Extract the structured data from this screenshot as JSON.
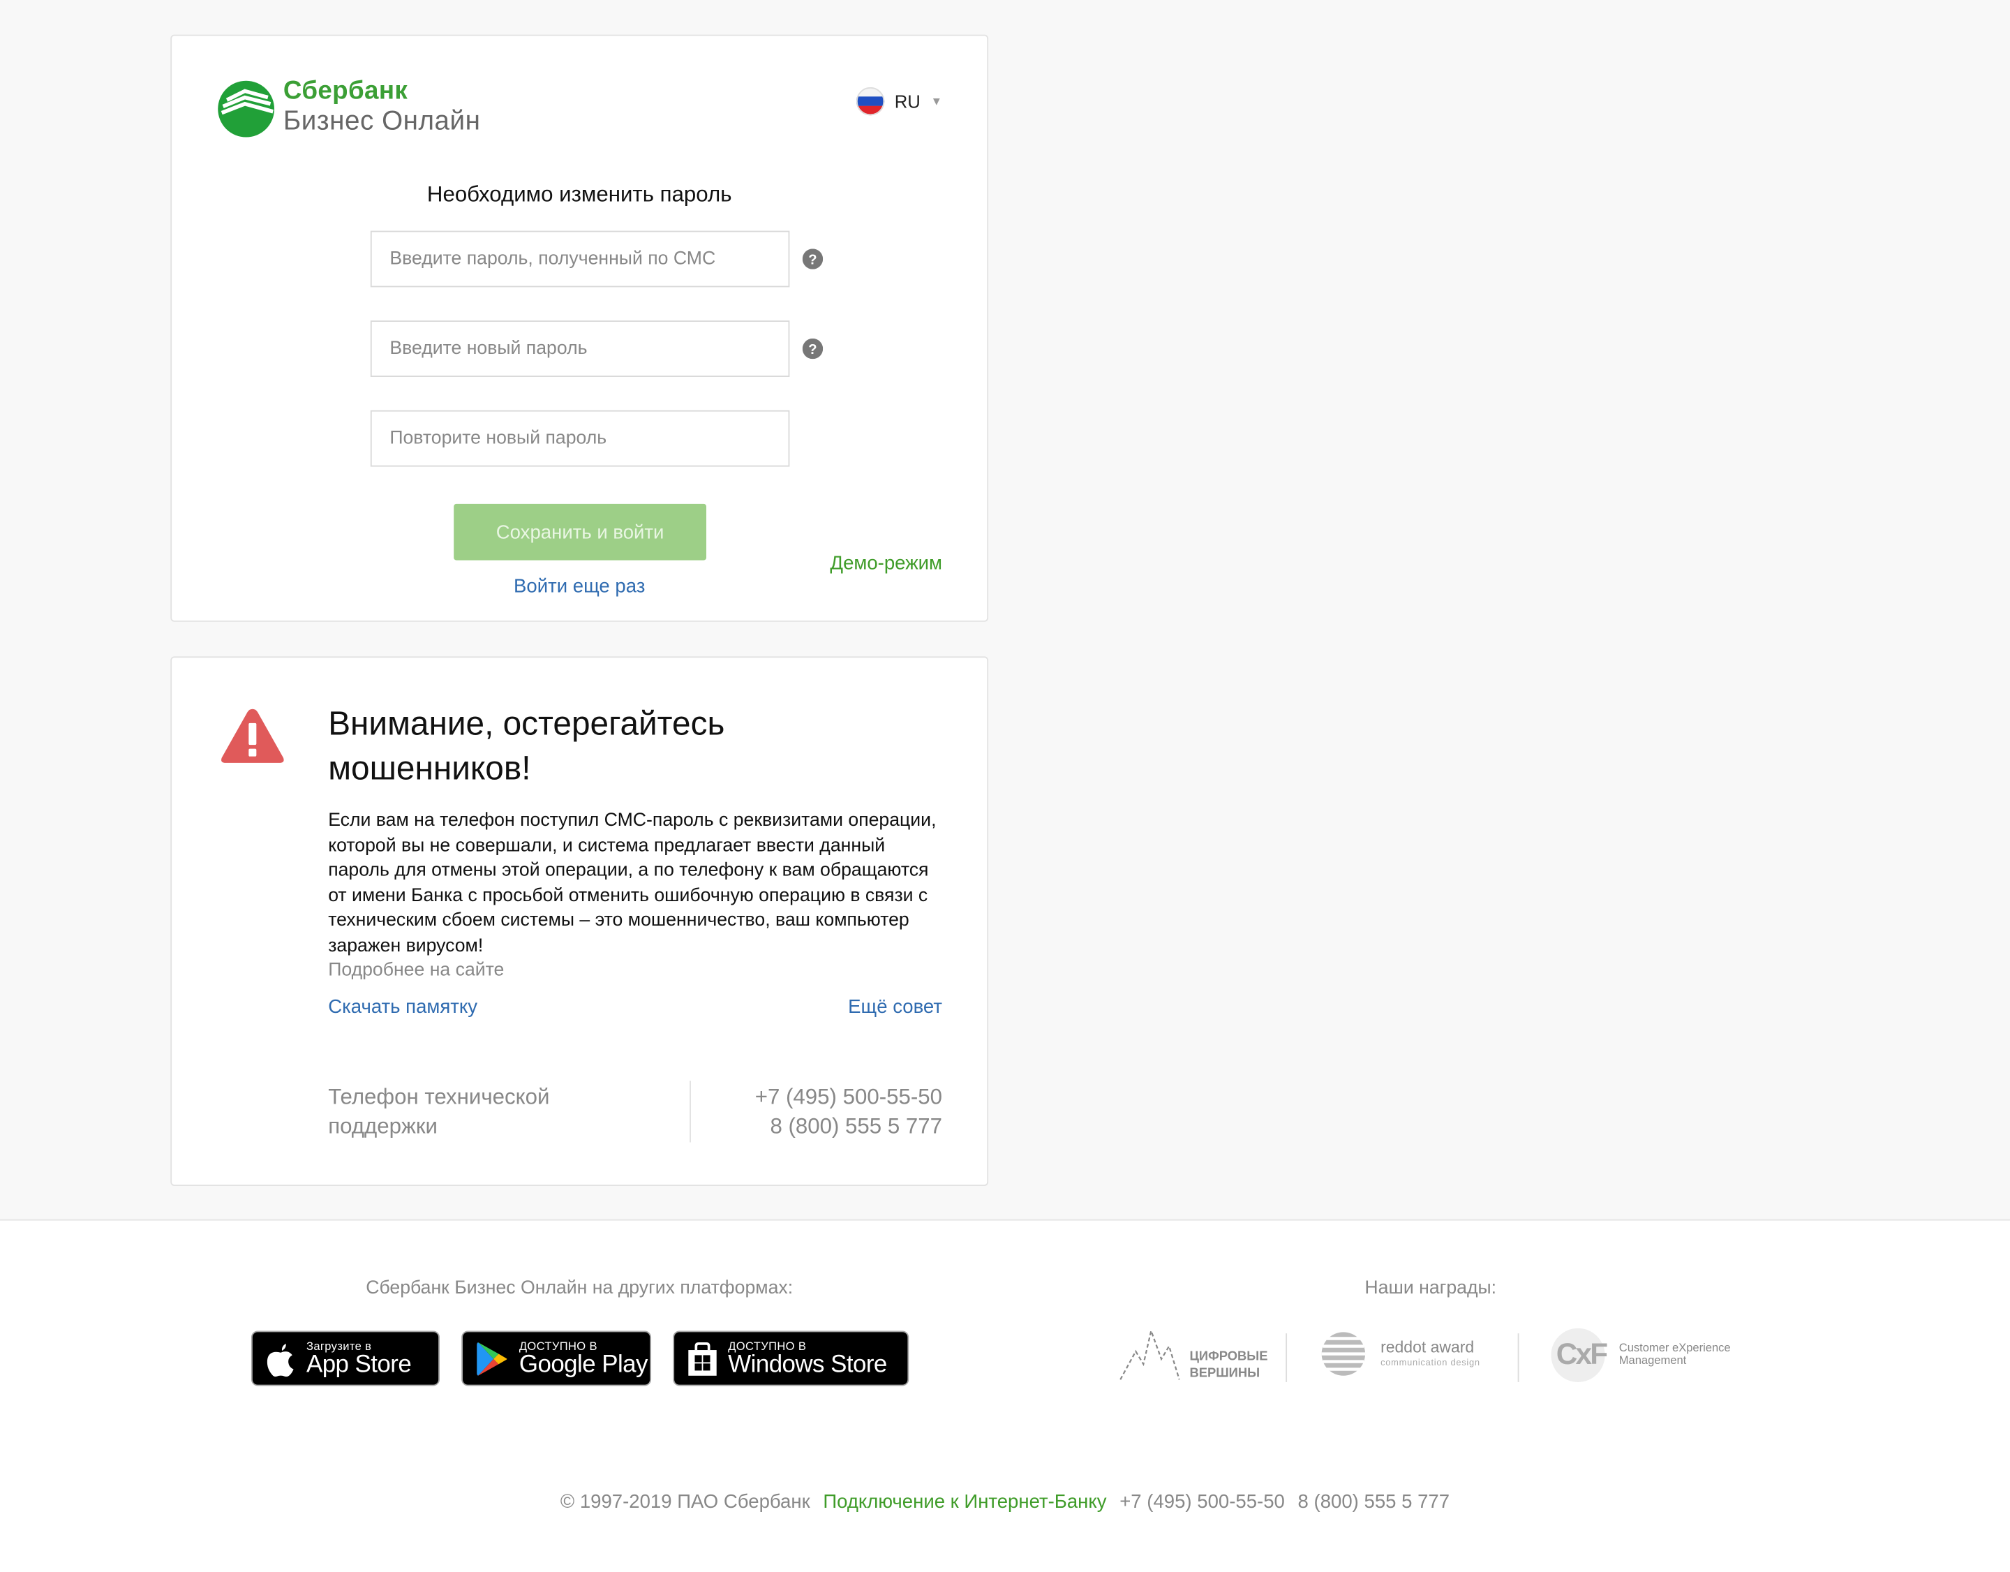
{
  "brand": {
    "name": "Сбербанк",
    "product": "Бизнес Онлайн",
    "accent": "#3f9c29",
    "link_color": "#2f6bb0"
  },
  "lang": {
    "label": "RU"
  },
  "form": {
    "title": "Необходимо изменить пароль",
    "sms_placeholder": "Введите пароль, полученный по СМС",
    "new_placeholder": "Введите новый пароль",
    "repeat_placeholder": "Повторите новый пароль",
    "save_label": "Сохранить и войти",
    "retry_label": "Войти еще раз",
    "demo_label": "Демо-режим"
  },
  "warning": {
    "title": "Внимание, остерегайтесь мошенников!",
    "text": "Если вам на телефон поступил СМС-пароль с реквизитами операции, которой вы не совершали, и система предлагает ввести данный пароль для отмены этой операции, а по телефону к вам обращаются от имени Банка с просьбой отменить ошибочную операцию в связи с техническим сбоем системы – это мошенничество, ваш компьютер заражен вирусом!",
    "more": "Подробнее на сайте",
    "memo_label": "Скачать памятку",
    "tip_label": "Ещё совет",
    "support_label": "Телефон технической поддержки",
    "phone1": "+7 (495) 500-55-50",
    "phone2": "8 (800) 555 5 777"
  },
  "platforms": {
    "title": "Сбербанк Бизнес Онлайн на других платформах:",
    "stores": [
      {
        "small": "Загрузите в",
        "big": "App Store",
        "icon": "apple-icon"
      },
      {
        "small": "ДОСТУПНО В",
        "big": "Google Play",
        "icon": "google-play-icon"
      },
      {
        "small": "ДОСТУПНО В",
        "big": "Windows Store",
        "icon": "windows-store-icon"
      }
    ]
  },
  "awards": {
    "title": "Наши награды:",
    "a1_line1": "ЦИФРОВЫЕ",
    "a1_line2": "ВЕРШИНЫ",
    "a2_line1": "reddot award",
    "a2_line2": "communication design",
    "a3_logo": "CxF",
    "a3_line1": "Customer eXperience",
    "a3_line2": "Management"
  },
  "footer": {
    "copyright": "© 1997-2019 ПАО Сбербанк",
    "connect_label": "Подключение к Интернет-Банку",
    "phone1": "+7 (495) 500-55-50",
    "phone2": "8 (800) 555 5 777"
  }
}
